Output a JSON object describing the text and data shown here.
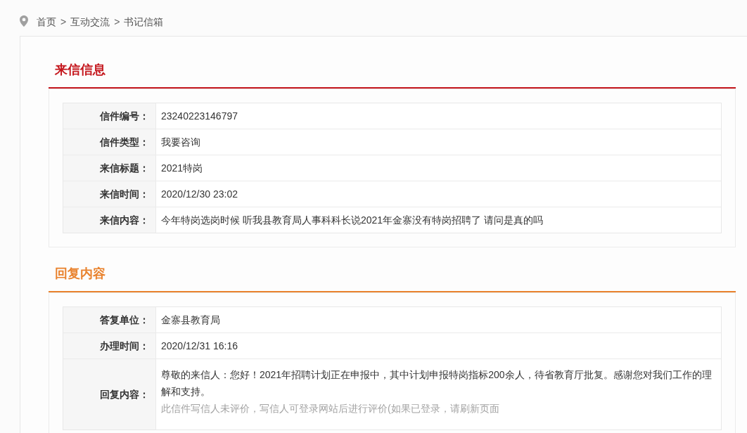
{
  "breadcrumb": {
    "items": [
      "首页",
      "互动交流",
      "书记信箱"
    ],
    "separators": [
      ">",
      ">"
    ]
  },
  "sections": [
    {
      "title": "来信信息",
      "color": "#c4161c",
      "rows": [
        {
          "label": "信件编号：",
          "value": "23240223146797"
        },
        {
          "label": "信件类型：",
          "value": "我要咨询"
        },
        {
          "label": "来信标题：",
          "value": "2021特岗"
        },
        {
          "label": "来信时间：",
          "value": "2020/12/30 23:02"
        },
        {
          "label": "来信内容：",
          "value": "今年特岗选岗时候 听我县教育局人事科科长说2021年金寨没有特岗招聘了 请问是真的吗"
        }
      ]
    },
    {
      "title": "回复内容",
      "color": "#e9822d",
      "rows": [
        {
          "label": "答复单位：",
          "value": "金寨县教育局"
        },
        {
          "label": "办理时间：",
          "value": "2020/12/31 16:16"
        },
        {
          "label": "回复内容：",
          "value": "尊敬的来信人：您好！2021年招聘计划正在申报中，其中计划申报特岗指标200余人，待省教育厅批复。感谢您对我们工作的理解和支持。",
          "note": "此信件写信人未评价，写信人可登录网站后进行评价(如果已登录，请刷新页面"
        }
      ]
    }
  ]
}
